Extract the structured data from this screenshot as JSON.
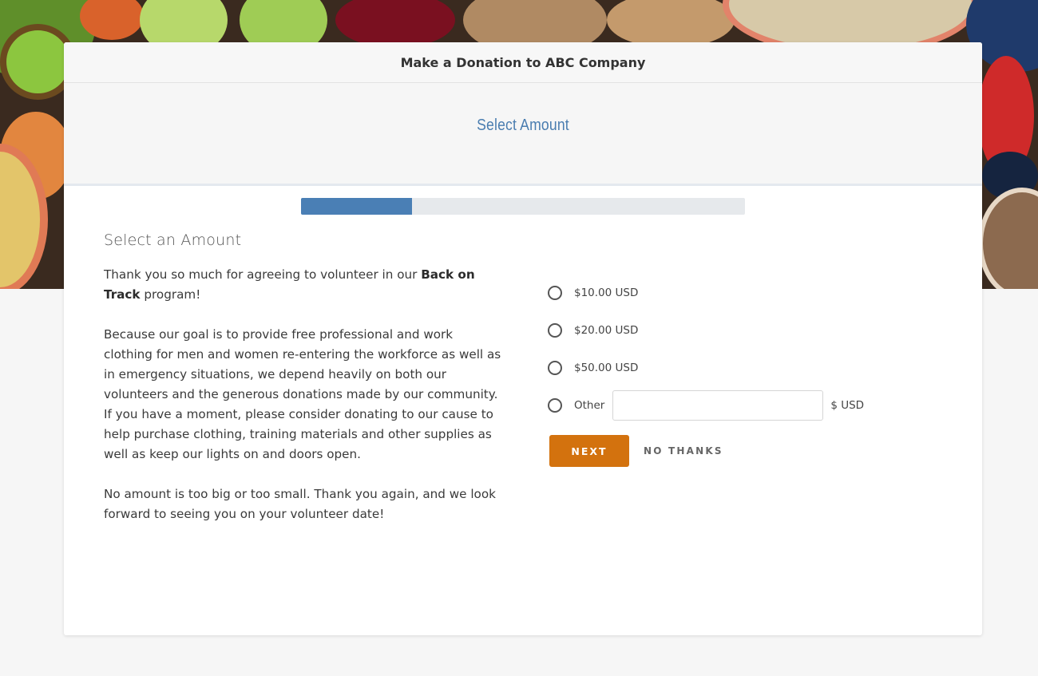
{
  "header": {
    "title": "Make a Donation to ABC Company"
  },
  "step": {
    "title": "Select Amount",
    "progress_fraction": 0.25
  },
  "content": {
    "section_title": "Select an Amount",
    "intro": {
      "p1_before": "Thank you so much for agreeing to volunteer in our ",
      "p1_bold": "Back on Track",
      "p1_after": " program!",
      "p2": "Because our goal is to provide free professional and work clothing for men and women re-entering the workforce as well as in emergency situations, we depend heavily on both our volunteers and the generous donations made by our community. If you have a moment, please consider donating to our cause to help purchase clothing, training materials and other supplies as well as keep our lights on and doors open.",
      "p3": "No amount is too big or too small. Thank you again, and we look forward to seeing you on your volunteer date!"
    }
  },
  "options": [
    {
      "label": "$10.00 USD"
    },
    {
      "label": "$20.00 USD"
    },
    {
      "label": "$50.00 USD"
    }
  ],
  "other": {
    "label": "Other",
    "value": "",
    "currency": "$ USD"
  },
  "actions": {
    "next_label": "NEXT",
    "no_thanks_label": "NO THANKS"
  },
  "colors": {
    "accent": "#d3720e",
    "step_title": "#4a7db0",
    "progress_fill": "#4a7fb5"
  }
}
